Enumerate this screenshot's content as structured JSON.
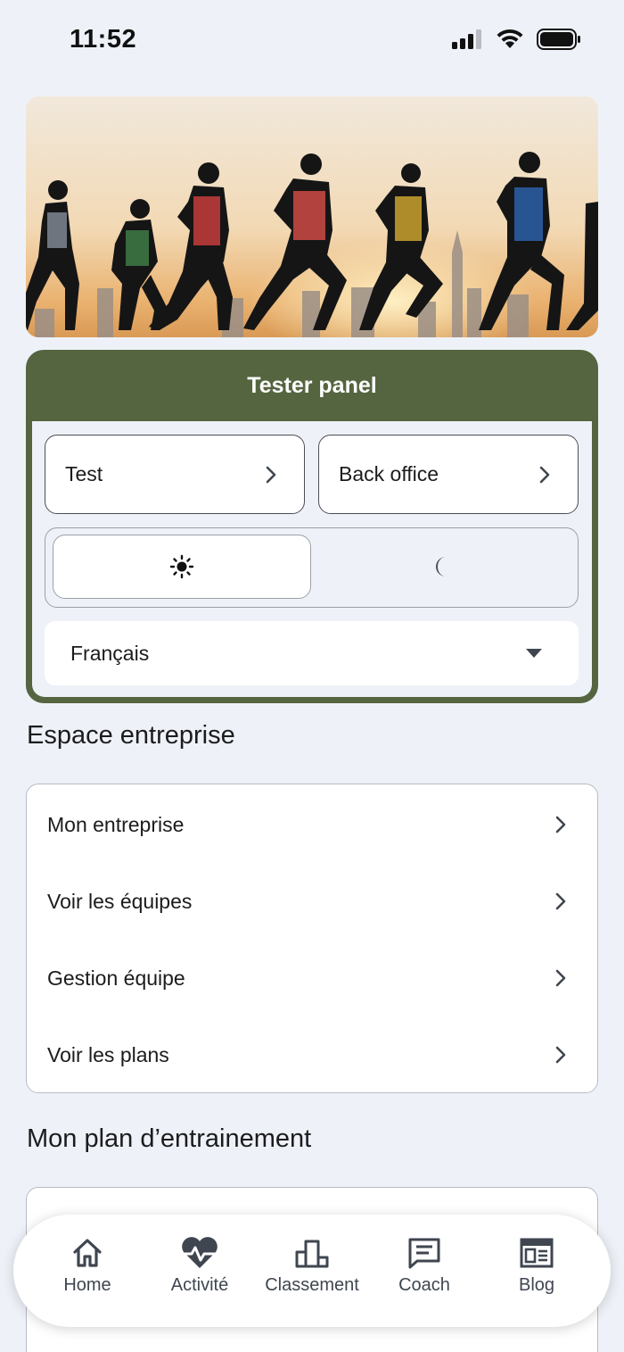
{
  "status_bar": {
    "time": "11:52"
  },
  "tester_panel": {
    "title": "Tester panel",
    "buttons": [
      {
        "label": "Test",
        "icon": "chevron-right-icon"
      },
      {
        "label": "Back office",
        "icon": "chevron-right-icon"
      }
    ],
    "theme": {
      "options": [
        "sun-icon",
        "moon-icon"
      ],
      "selected": "light"
    },
    "language": {
      "value": "Français",
      "icon": "caret-down-icon"
    }
  },
  "company_section": {
    "title": "Espace entreprise",
    "items": [
      {
        "label": "Mon entreprise"
      },
      {
        "label": "Voir les équipes"
      },
      {
        "label": "Gestion équipe"
      },
      {
        "label": "Voir les plans"
      }
    ]
  },
  "plan_section": {
    "title": "Mon plan d’entrainement"
  },
  "bottom_nav": {
    "tabs": [
      {
        "label": "Home",
        "icon": "home-icon"
      },
      {
        "label": "Activité",
        "icon": "heart-pulse-icon"
      },
      {
        "label": "Classement",
        "icon": "leaderboard-icon"
      },
      {
        "label": "Coach",
        "icon": "chat-icon"
      },
      {
        "label": "Blog",
        "icon": "newspaper-icon"
      }
    ]
  },
  "colors": {
    "background": "#eef2f8",
    "panel_green": "#556540",
    "nav_icon": "#3f4650"
  }
}
